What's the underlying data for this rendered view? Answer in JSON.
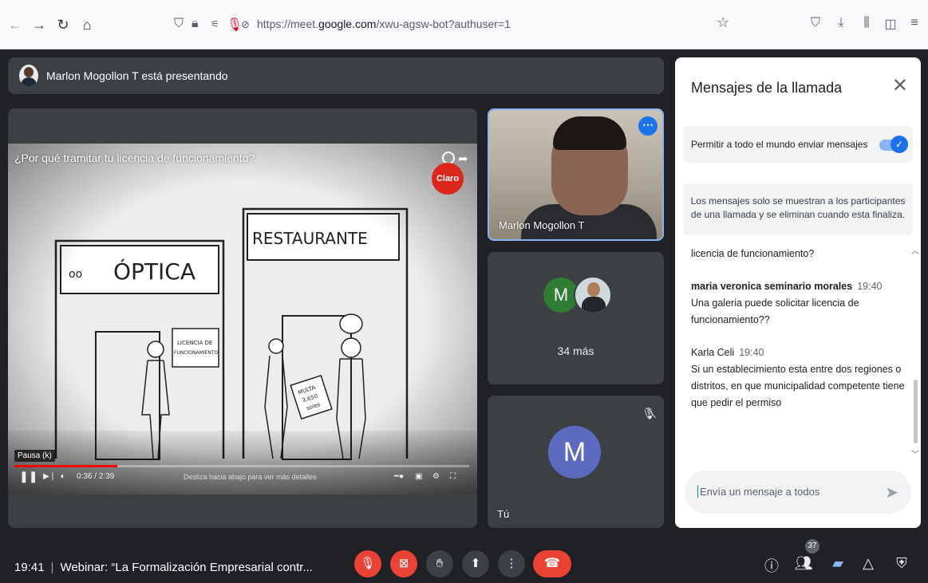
{
  "browser": {
    "url_prefix": "https://meet.",
    "url_domain": "google.com",
    "url_path": "/xwu-agsw-bot?authuser=1",
    "nav_icons": [
      "back-icon",
      "forward-icon",
      "reload-icon",
      "home-icon"
    ],
    "right_icons": [
      "bookmark-star-icon",
      "pocket-icon",
      "download-icon",
      "library-icon",
      "sidebar-icon",
      "menu-icon"
    ]
  },
  "presenting": {
    "text": "Marlon Mogollon T está presentando"
  },
  "video": {
    "title": "¿Por qué tramitar tu licencia de funcionamiento?",
    "logo": "Claro",
    "pause_tooltip": "Pausa (k)",
    "time": "0:36 / 2:39",
    "progress_fraction": 0.226,
    "swipe_hint": "Desliza hacia abajo para ver más detalles",
    "scene": {
      "shop1_sign": "ÓPTICA",
      "shop1_logo": "oo",
      "shop2_sign": "RESTAURANTE",
      "paper_sign": [
        "LICENCIA DE",
        "FUNCIONAMIENTO"
      ],
      "fine_paper": [
        "MULTA",
        "3,650",
        "soles"
      ]
    }
  },
  "tiles": {
    "presenter_name": "Marlon Mogollon T",
    "more_initial": "M",
    "more_count": "34 más",
    "self_initial": "M",
    "self_label": "Tú"
  },
  "chat": {
    "title": "Mensajes de la llamada",
    "permission_label": "Permitir a todo el mundo enviar mensajes",
    "info": "Los mensajes solo se muestran a los participantes de una llamada y se eliminan cuando esta finaliza.",
    "continuation": "licencia de funcionamiento?",
    "messages": [
      {
        "sender": "maria veronica seminario morales",
        "time": "19:40",
        "lines": [
          "Una galeria puede solicitar licencia de",
          "funcionamiento??"
        ]
      },
      {
        "sender": "Karla Celi",
        "time": "19:40",
        "lines": [
          "Si un establecimiento esta entre dos regiones o",
          "distritos, en que municipalidad competente tiene",
          "que pedir el permiso"
        ]
      }
    ],
    "input_placeholder": "Envía un mensaje a todos"
  },
  "bottom": {
    "time": "19:41",
    "meeting_title": "Webinar: “La Formalización Empresarial contr...",
    "people_count": "37"
  },
  "colors": {
    "meet_bg": "#202124",
    "tile_bg": "#3c4043",
    "accent_blue": "#1a73e8",
    "danger_red": "#ea4335",
    "avatar_green": "#2e7d32",
    "avatar_purple": "#5c6bc0"
  }
}
